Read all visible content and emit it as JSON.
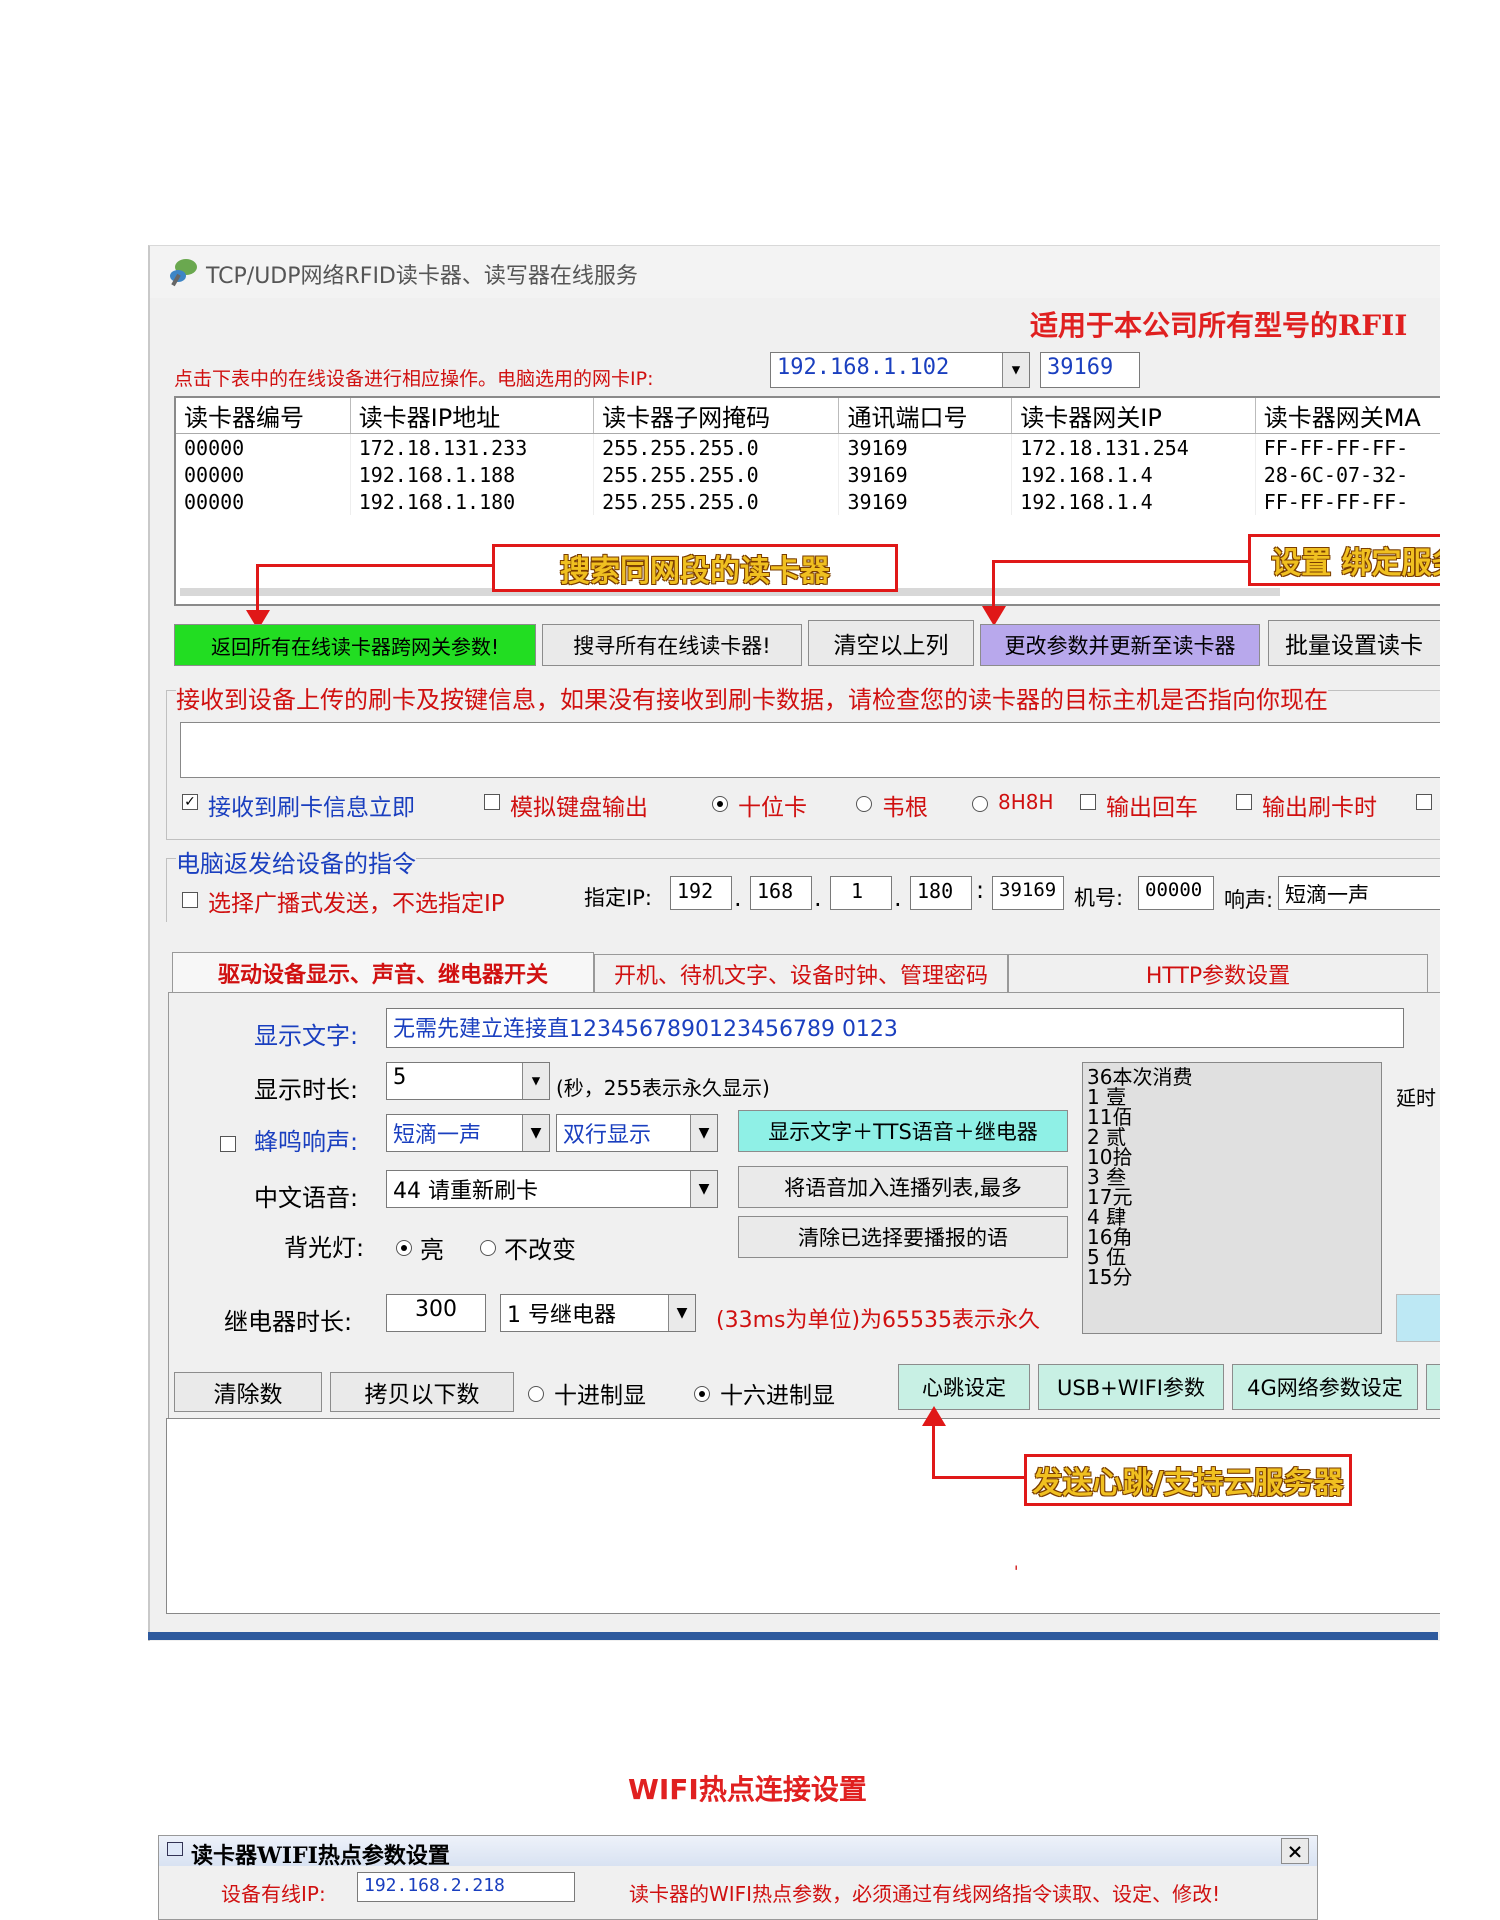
{
  "window": {
    "title": "TCP/UDP网络RFID读卡器、读写器在线服务",
    "subtitle": "适用于本公司所有型号的RFII",
    "hint": "点击下表中的在线设备进行相应操作。电脑选用的网卡IP:",
    "nic_ip": "192.168.1.102",
    "port": "39169"
  },
  "grid": {
    "columns": [
      "读卡器编号",
      "读卡器IP地址",
      "读卡器子网掩码",
      "通讯端口号",
      "读卡器网关IP",
      "读卡器网关MA"
    ],
    "rows": [
      [
        "00000",
        "172.18.131.233",
        "255.255.255.0",
        "39169",
        "172.18.131.254",
        "FF-FF-FF-FF-"
      ],
      [
        "00000",
        "192.168.1.188",
        "255.255.255.0",
        "39169",
        "192.168.1.4",
        "28-6C-07-32-"
      ],
      [
        "00000",
        "192.168.1.180",
        "255.255.255.0",
        "39169",
        "192.168.1.4",
        "FF-FF-FF-FF-"
      ]
    ]
  },
  "callouts": {
    "search": "搜索同网段的读卡器",
    "bind": "设置 绑定服务器IP参数",
    "heartbeat": "发送心跳/支持云服务器"
  },
  "buttons": {
    "return_params": "返回所有在线读卡器跨网关参数!",
    "search_all": "搜寻所有在线读卡器!",
    "clear_list": "清空以上列",
    "update_params": "更改参数并更新至读卡器",
    "batch": "批量设置读卡",
    "show_tts": "显示文字＋TTS语音＋继电器",
    "add_voice": "将语音加入连播列表,最多",
    "clear_voice": "清除已选择要播报的语",
    "clear_data": "清除数",
    "copy_data": "拷贝以下数",
    "heartbeat": "心跳设定",
    "usb_wifi": "USB+WIFI参数",
    "net4g": "4G网络参数设定"
  },
  "receive": {
    "label": "接收到设备上传的刷卡及按键信息，如果没有接收到刷卡数据，请检查您的读卡器的目标主机是否指向你现在",
    "opt_receive": "接收到刷卡信息立即",
    "opt_keyboard": "模拟键盘输出",
    "opt_ten": "十位卡",
    "opt_wiegand": "韦根",
    "opt_8h8h": "8H8H",
    "opt_enter": "输出回车",
    "opt_time": "输出刷卡时"
  },
  "command": {
    "label": "电脑返发给设备的指令",
    "broadcast": "选择广播式发送，不选指定IP",
    "ip_label": "指定IP:",
    "ip": [
      "192",
      "168",
      "1",
      "180"
    ],
    "port": "39169",
    "machine_label": "机号:",
    "machine": "00000",
    "sound_label": "响声:",
    "sound": "短滴一声"
  },
  "tabs": [
    "驱动设备显示、声音、继电器开关",
    "开机、待机文字、设备时钟、管理密码",
    "HTTP参数设置"
  ],
  "display": {
    "text_label": "显示文字:",
    "text": "无需先建立连接直1234567890123456789 0123",
    "duration_label": "显示时长:",
    "duration": "5",
    "duration_hint": "(秒，255表示永久显示)",
    "beep_label": "蜂鸣响声:",
    "beep": "短滴一声",
    "lines": "双行显示",
    "voice_label": "中文语音:",
    "voice": "44 请重新刷卡",
    "backlight_label": "背光灯:",
    "bl_on": "亮",
    "bl_keep": "不改变",
    "relay_label": "继电器时长:",
    "relay_time": "300",
    "relay": "1 号继电器",
    "relay_hint": "(33ms为单位)为65535表示永久",
    "delay": "延时",
    "voice_list": [
      "36本次消费",
      "1 壹",
      "11佰",
      "2 贰",
      "10拾",
      "3 叁",
      "17元",
      "4 肆",
      "16角",
      "5 伍",
      "15分"
    ]
  },
  "bottom": {
    "dec": "十进制显",
    "hex": "十六进制显",
    "dot": "'"
  },
  "wifi": {
    "section_title": "WIFI热点连接设置",
    "dialog_title": "读卡器WIFI热点参数设置",
    "ip_label": "设备有线IP:",
    "ip": "192.168.2.218",
    "notice": "读卡器的WIFI热点参数，必须通过有线网络指令读取、设定、修改!",
    "close": "×"
  }
}
